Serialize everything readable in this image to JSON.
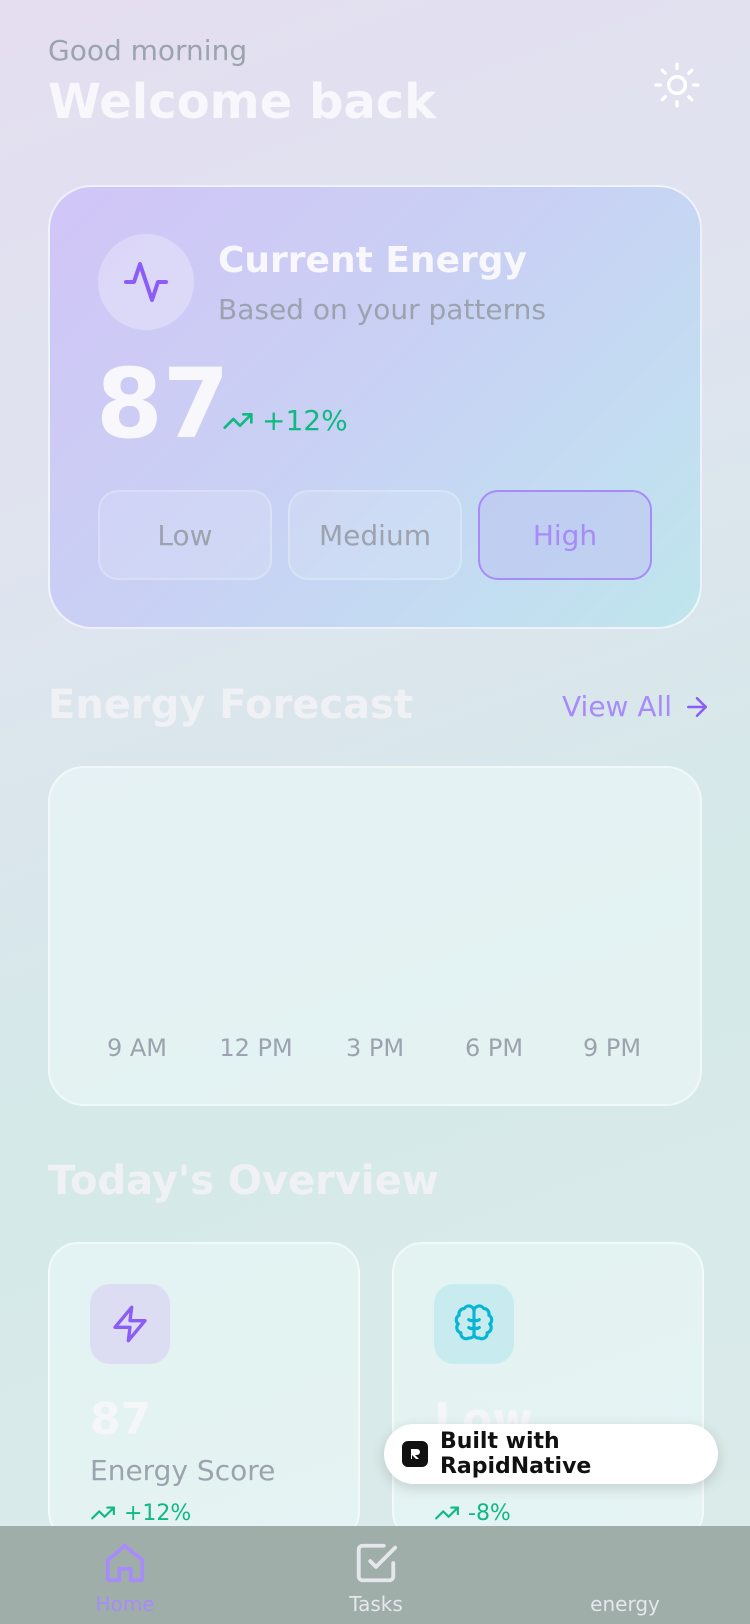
{
  "header": {
    "greeting": "Good morning",
    "title": "Welcome back",
    "theme_icon": "sun-icon"
  },
  "energy_card": {
    "icon": "activity-pulse-icon",
    "title": "Current Energy",
    "subtitle": "Based on your patterns",
    "score": "87",
    "trend": "+12%",
    "levels": [
      "Low",
      "Medium",
      "High"
    ],
    "selected_level": "High"
  },
  "forecast": {
    "title": "Energy Forecast",
    "view_all": "View All",
    "times": [
      "9 AM",
      "12 PM",
      "3 PM",
      "6 PM",
      "9 PM"
    ]
  },
  "overview": {
    "title": "Today's Overview",
    "cards": [
      {
        "icon": "lightning-icon",
        "value": "87",
        "label": "Energy Score",
        "change": "+12%"
      },
      {
        "icon": "brain-icon",
        "value": "Low",
        "label": "",
        "change": "-8%"
      }
    ]
  },
  "badge": {
    "text": "Built with RapidNative"
  },
  "tabbar": {
    "tabs": [
      {
        "label": "Home",
        "icon": "home-icon",
        "active": true
      },
      {
        "label": "Tasks",
        "icon": "checkbox-icon",
        "active": false
      },
      {
        "label": "energy",
        "icon": "",
        "active": false
      }
    ]
  },
  "colors": {
    "accent": "#a78bfa",
    "positive": "#10b981",
    "muted": "#9ca3af",
    "cyan_icon": "#06b6d4"
  }
}
